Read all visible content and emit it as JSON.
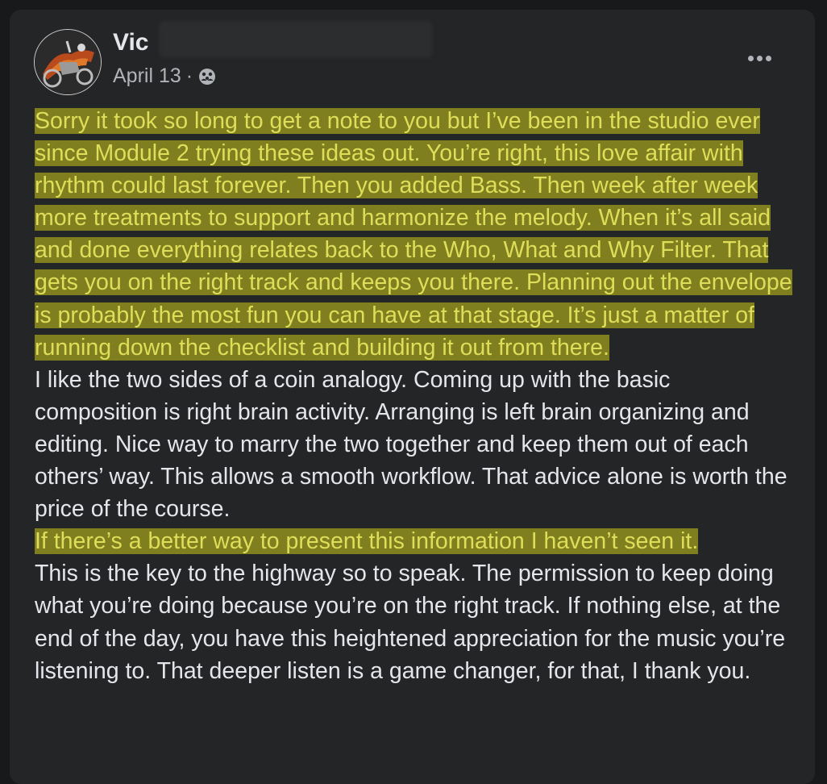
{
  "post": {
    "author": "Vic",
    "date": "April 13",
    "separator": "·",
    "audience_icon": "friends-audience-icon",
    "more_icon": "more-options-icon",
    "paragraphs": [
      {
        "highlighted": true,
        "text": "Sorry it took so long to get a note to you but I’ve been in the studio ever since Module 2 trying these ideas out.  You’re right, this love affair with rhythm could last forever.  Then you added Bass.  Then week after week more treatments to support and harmonize the melody.  When it’s all said and done everything relates back to the Who, What and Why Filter.  That gets you on the right track and keeps you there.  Planning out the envelope is probably the most fun you can have at that stage.  It’s just a matter of running down the checklist and building it out from there."
      },
      {
        "highlighted": false,
        "text": "I like the two sides of a coin analogy.  Coming up with the basic composition is right brain activity.  Arranging is left brain organizing and editing.  Nice way to marry the two together and keep them out of each others’ way.  This allows a smooth workflow.  That advice alone is worth the price of the course."
      },
      {
        "highlighted": true,
        "text": "If there’s a better way to present this information I haven’t seen it."
      },
      {
        "highlighted": false,
        "text": "This is the key to the highway so to speak.  The permission to keep doing what you’re doing because you’re on the right track.  If nothing else, at the end of the day, you have this heightened appreciation for the music you’re listening to.  That deeper listen is a game changer, for that, I thank you."
      }
    ]
  },
  "colors": {
    "page_bg": "#18191a",
    "card_bg": "#242526",
    "text": "#e4e6eb",
    "secondary_text": "#b0b3b8",
    "highlight_bg": "#7f7f1f",
    "highlight_text": "#dede5a"
  }
}
